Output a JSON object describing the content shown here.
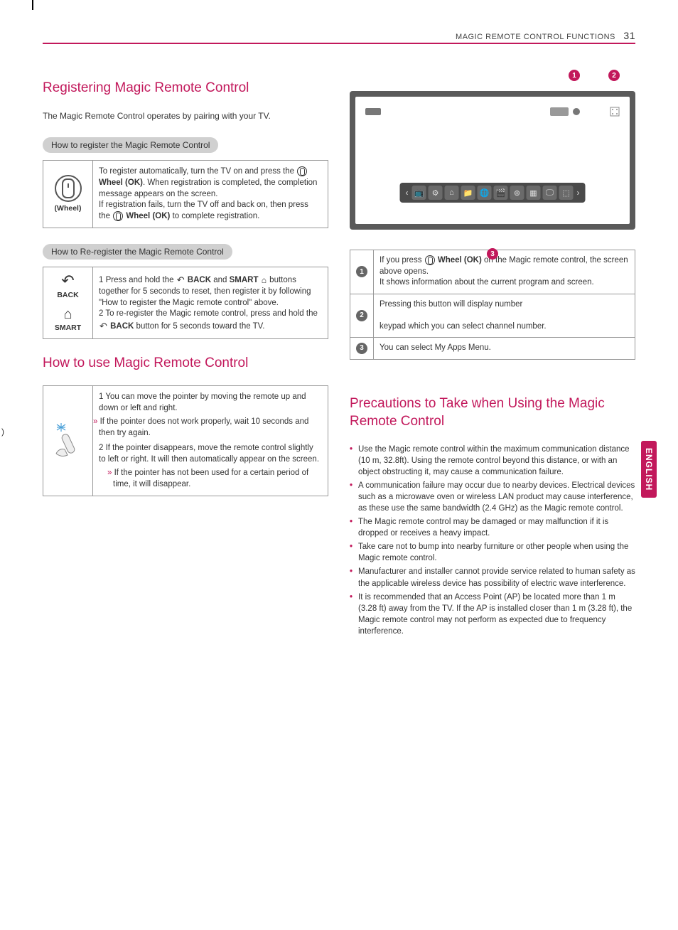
{
  "header": {
    "section": "MAGIC REMOTE CONTROL FUNCTIONS",
    "page": "31"
  },
  "lang_tab": "ENGLISH",
  "h_register": "Registering Magic Remote Control",
  "intro_register": "The Magic Remote Control operates by pairing with your TV.",
  "pill_register": "How to register the Magic Remote Control",
  "wheel_label": "(Wheel)",
  "register_text1": "To register automatically, turn the TV on and press the ",
  "register_wheelok": "Wheel (OK)",
  "register_text2": ". When registration is completed, the completion message appears on the screen.",
  "register_text3": "If registration fails, turn the TV off and back on, then press the ",
  "register_text4": " to complete registration.",
  "pill_reregister": "How to Re-register the Magic Remote Control",
  "back_label": "BACK",
  "smart_label": "SMART",
  "rereg_1a": "1 Press and hold the ",
  "rereg_back": "BACK",
  "rereg_1b": " and ",
  "rereg_smart": "SMART",
  "rereg_1c": " buttons together for 5 seconds to reset, then register it by following \"How to register the Magic remote control\" above.",
  "rereg_2a": "2 To re-register the Magic remote control, press and hold the ",
  "rereg_2b": " button for 5 seconds toward the TV.",
  "h_use": "How to use Magic Remote Control",
  "use_1": "1 You can move the pointer by moving the remote up and down or left and right.",
  "use_1s": "If the pointer does not work properly, wait 10 seconds and then try again.",
  "use_2": "2 If the pointer disappears, move the remote control slightly to left or right. It will then automatically appear on the screen.",
  "use_2s": "If the pointer has not been used for a certain period of time, it will disappear.",
  "legend": {
    "r1a": "If you press ",
    "r1b": " on the Magic remote control, the screen above opens.",
    "r1c": "It shows information about the current program and screen.",
    "r2a": "Pressing this button will display number",
    "r2b": "keypad which you can select channel number.",
    "r3": "You can select My Apps Menu."
  },
  "h_precautions": "Precautions to Take when Using the Magic Remote Control",
  "prec": [
    "Use the Magic remote control within the maximum communication distance (10 m, 32.8ft). Using the remote control beyond this distance, or with an object obstructing it, may cause a communication failure.",
    "A communication failure may occur due to nearby devices. Electrical devices such as a microwave oven or wireless LAN product may cause interference, as these use the same bandwidth (2.4 GHz) as the Magic remote control.",
    "The Magic remote control may be damaged or may malfunction if it is dropped or receives a heavy impact.",
    "Take care not to bump into nearby furniture or other people when using the Magic remote control.",
    "Manufacturer and installer cannot provide service related to human safety as the applicable wireless device has possibility of electric wave interference.",
    "It is recommended that an Access Point (AP) be located more than 1 m (3.28 ft) away from the TV. If the AP is installed closer than 1 m (3.28 ft), the Magic remote control may not perform as expected due to frequency interference."
  ]
}
